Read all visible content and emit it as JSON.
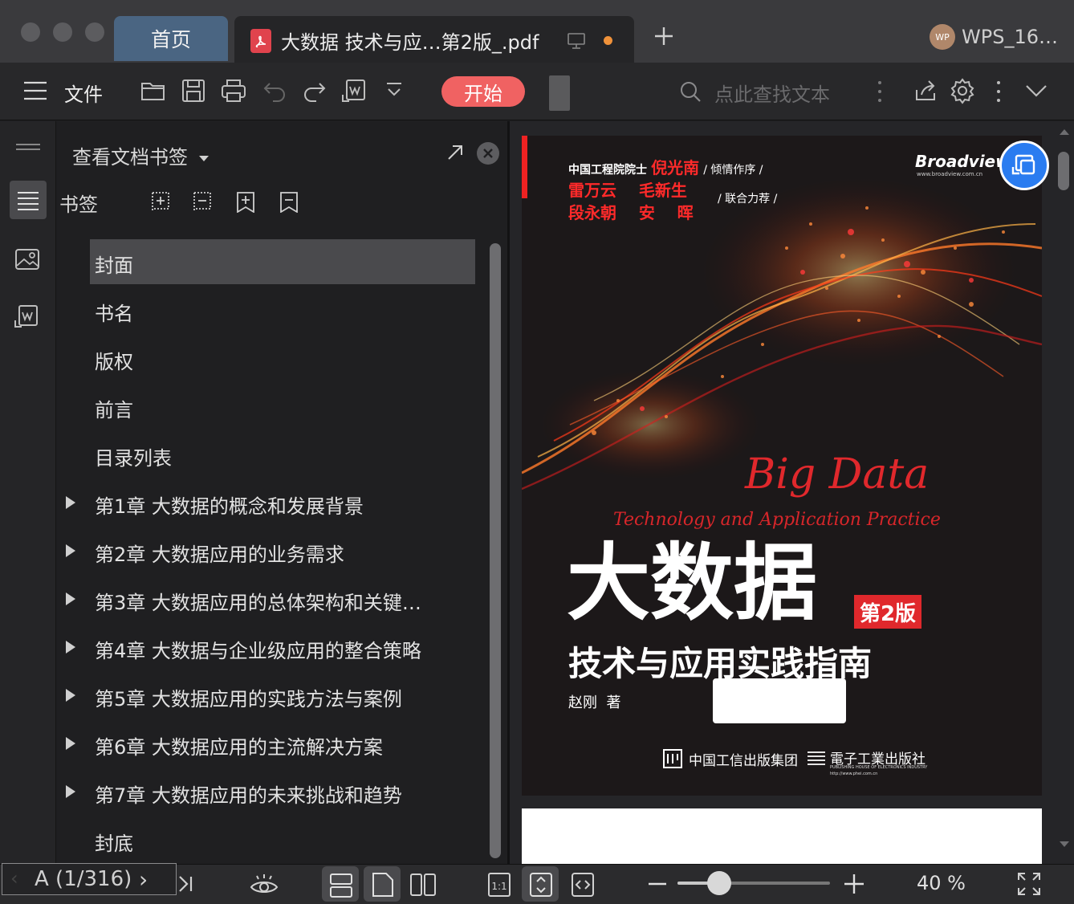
{
  "titlebar": {
    "tabs": [
      {
        "label": "首页"
      },
      {
        "label": "大数据 技术与应…第2版_.pdf"
      }
    ],
    "account_name": "WPS_16…",
    "account_avatar_text": "WP",
    "unsaved_indicator_color": "#f0923a"
  },
  "toolbar": {
    "menu_label": "文件",
    "start_label": "开始",
    "search_placeholder": "点此查找文本",
    "start_color": "#f06262"
  },
  "sidebar": {
    "panel_title": "查看文档书签",
    "bookmark_label": "书签",
    "items": [
      {
        "label": "封面",
        "expandable": false,
        "selected": true
      },
      {
        "label": "书名",
        "expandable": false
      },
      {
        "label": "版权",
        "expandable": false
      },
      {
        "label": "前言",
        "expandable": false
      },
      {
        "label": "目录列表",
        "expandable": false
      },
      {
        "label": "第1章  大数据的概念和发展背景",
        "expandable": true
      },
      {
        "label": "第2章  大数据应用的业务需求",
        "expandable": true
      },
      {
        "label": "第3章  大数据应用的总体架构和关键…",
        "expandable": true
      },
      {
        "label": "第4章  大数据与企业级应用的整合策略",
        "expandable": true
      },
      {
        "label": "第5章  大数据应用的实践方法与案例",
        "expandable": true
      },
      {
        "label": "第6章  大数据应用的主流解决方案",
        "expandable": true
      },
      {
        "label": "第7章  大数据应用的未来挑战和趋势",
        "expandable": true
      },
      {
        "label": "封底",
        "expandable": false
      }
    ]
  },
  "document": {
    "cover": {
      "academician_prefix": "中国工程院院士",
      "academician_name": "倪光南",
      "preface_note": "/ 倾情作序 /",
      "recommenders_line1": "雷万云    毛新生",
      "recommenders_line2": "段永朝    安    晖",
      "recommend_note": "/ 联合力荐 /",
      "publisher_brand": "Broadview",
      "publisher_url": "www.broadview.com.cn",
      "en_title": "Big Data",
      "en_subtitle": "Technology and Application Practice",
      "title": "大数据",
      "edition": "第2版",
      "subtitle": "技术与应用实践指南",
      "author": "赵刚  著",
      "publisher1": "中国工信出版集团",
      "publisher2": "電子工業出版社",
      "publisher2_en": "PUBLISHING HOUSE OF ELECTRONICS INDUSTRY",
      "publisher2_url": "http://www.phei.com.cn"
    }
  },
  "statusbar": {
    "page_indicator": "A (1/316)",
    "current_page": 1,
    "total_pages": 316,
    "zoom_label": "40 %",
    "zoom_percent": 40
  }
}
